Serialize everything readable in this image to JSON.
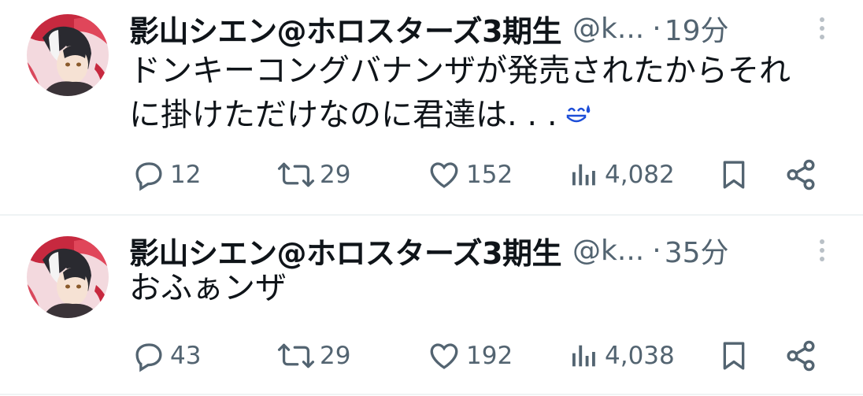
{
  "tweets": [
    {
      "display_name": "影山シエン@ホロスターズ3期生",
      "handle": "@k...",
      "dot": "·",
      "time": "19分",
      "text_line1": "ドンキーコングバナンザが発売されたからそれ",
      "text_line2": "に掛けただけなのに君達は. . .",
      "emoji": "sweat-smile-emoji",
      "replies": "12",
      "retweets": "29",
      "likes": "152",
      "views": "4,082"
    },
    {
      "display_name": "影山シエン@ホロスターズ3期生",
      "handle": "@k...",
      "dot": "·",
      "time": "35分",
      "text_line1": "おふぁンザ",
      "replies": "43",
      "retweets": "29",
      "likes": "192",
      "views": "4,038"
    }
  ],
  "icons": {
    "reply": "reply-icon",
    "retweet": "retweet-icon",
    "like": "heart-icon",
    "views": "views-bar-chart-icon",
    "bookmark": "bookmark-icon",
    "share": "share-icon",
    "more": "more-vertical-icon"
  },
  "colors": {
    "text": "#0f1419",
    "secondary": "#536471",
    "divider": "#eff3f4",
    "emoji_blue": "#1d4ed8"
  }
}
